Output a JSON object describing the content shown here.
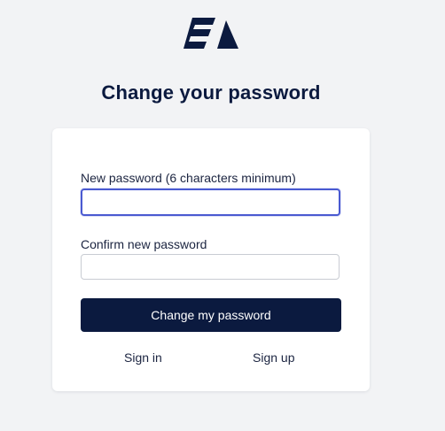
{
  "page": {
    "title": "Change your password"
  },
  "brand": {
    "logo_icon": "brand-logo-icon",
    "color": "#0b1a3f"
  },
  "form": {
    "new_password_label": "New password (6 characters minimum)",
    "new_password_value": "",
    "confirm_password_label": "Confirm new password",
    "confirm_password_value": "",
    "submit_label": "Change my password",
    "focus_color": "#4a5ad1"
  },
  "links": {
    "sign_in": "Sign in",
    "sign_up": "Sign up"
  }
}
